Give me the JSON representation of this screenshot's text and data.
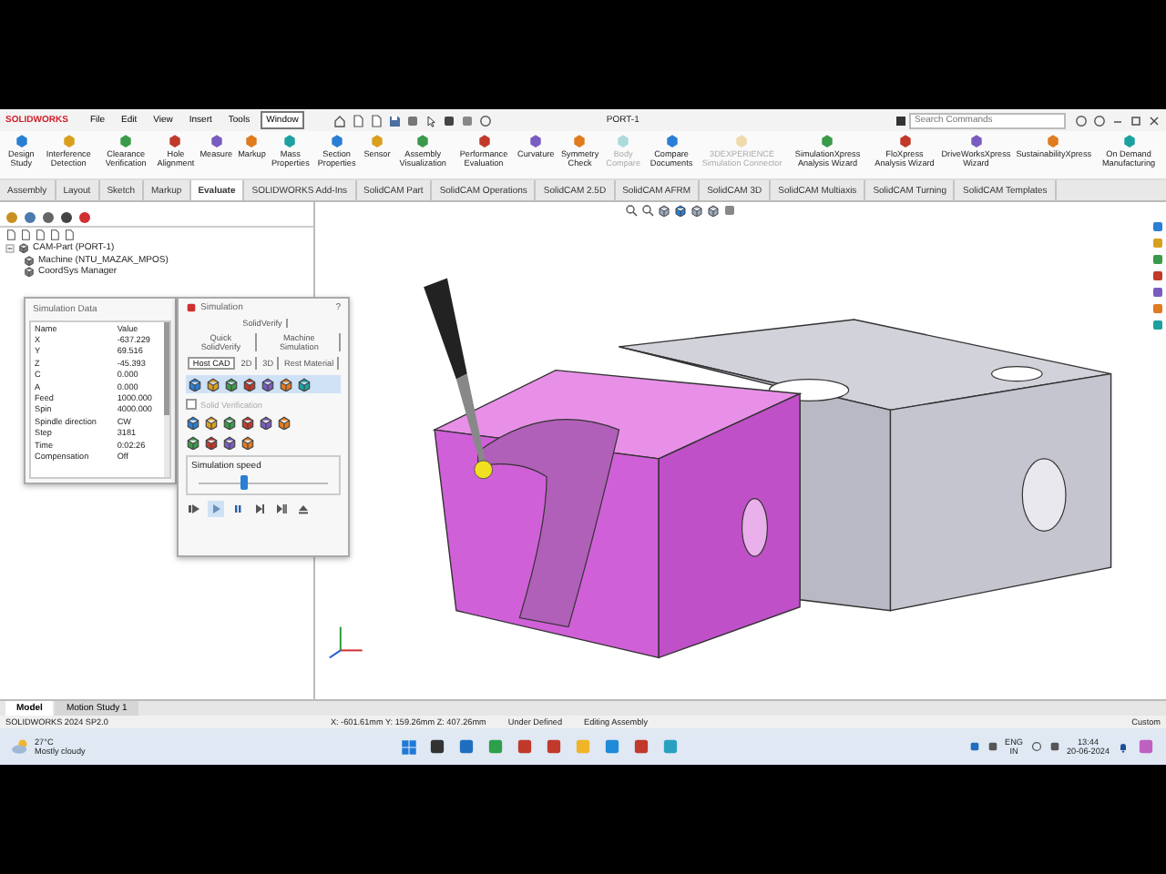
{
  "title_bar": {
    "logo": "SOLIDWORKS",
    "menus": [
      {
        "label": "File",
        "selected": false
      },
      {
        "label": "Edit",
        "selected": false
      },
      {
        "label": "View",
        "selected": false
      },
      {
        "label": "Insert",
        "selected": false
      },
      {
        "label": "Tools",
        "selected": false
      },
      {
        "label": "Window",
        "selected": true
      }
    ],
    "document_title": "PORT-1",
    "search": {
      "placeholder": "Search Commands"
    }
  },
  "ribbon": {
    "buttons": [
      {
        "label": "Design Study",
        "disabled": false
      },
      {
        "label": "Interference Detection",
        "disabled": false
      },
      {
        "label": "Clearance Verification",
        "disabled": false
      },
      {
        "label": "Hole Alignment",
        "disabled": false
      },
      {
        "label": "Measure",
        "disabled": false
      },
      {
        "label": "Markup",
        "disabled": false
      },
      {
        "label": "Mass Properties",
        "disabled": false
      },
      {
        "label": "Section Properties",
        "disabled": false
      },
      {
        "label": "Sensor",
        "disabled": false
      },
      {
        "label": "Assembly Visualization",
        "disabled": false
      },
      {
        "label": "Performance Evaluation",
        "disabled": false
      },
      {
        "label": "Curvature",
        "disabled": false
      },
      {
        "label": "Symmetry Check",
        "disabled": false
      },
      {
        "label": "Body Compare",
        "disabled": true
      },
      {
        "label": "Compare Documents",
        "disabled": false
      },
      {
        "label": "3DEXPERIENCE Simulation Connector",
        "disabled": true
      },
      {
        "label": "SimulationXpress Analysis Wizard",
        "disabled": false
      },
      {
        "label": "FloXpress Analysis Wizard",
        "disabled": false
      },
      {
        "label": "DriveWorksXpress Wizard",
        "disabled": false
      },
      {
        "label": "SustainabilityXpress",
        "disabled": false
      },
      {
        "label": "On Demand Manufacturing",
        "disabled": false
      }
    ]
  },
  "command_tabs": [
    {
      "label": "Assembly",
      "selected": false
    },
    {
      "label": "Layout",
      "selected": false
    },
    {
      "label": "Sketch",
      "selected": false
    },
    {
      "label": "Markup",
      "selected": false
    },
    {
      "label": "Evaluate",
      "selected": true
    },
    {
      "label": "SOLIDWORKS Add-Ins",
      "selected": false
    },
    {
      "label": "SolidCAM Part",
      "selected": false
    },
    {
      "label": "SolidCAM Operations",
      "selected": false
    },
    {
      "label": "SolidCAM 2.5D",
      "selected": false
    },
    {
      "label": "SolidCAM AFRM",
      "selected": false
    },
    {
      "label": "SolidCAM 3D",
      "selected": false
    },
    {
      "label": "SolidCAM Multiaxis",
      "selected": false
    },
    {
      "label": "SolidCAM Turning",
      "selected": false
    },
    {
      "label": "SolidCAM Templates",
      "selected": false
    }
  ],
  "feature_tree": {
    "items": [
      {
        "label": "CAM-Part (PORT-1)",
        "expanded": true,
        "children": [
          {
            "label": "Machine (NTU_MAZAK_MPOS)"
          },
          {
            "label": "CoordSys Manager"
          }
        ]
      }
    ]
  },
  "simulation_data": {
    "title": "Simulation Data",
    "columns": [
      "Name",
      "Value"
    ],
    "rows": [
      [
        "X",
        "-637.229"
      ],
      [
        "Y",
        "69.516"
      ],
      [
        "Z",
        "-45.393"
      ],
      [
        "C",
        "0.000"
      ],
      [
        "A",
        "0.000"
      ],
      [
        "Feed",
        "1000.000"
      ],
      [
        "Spin",
        "4000.000"
      ],
      [
        "Spindle direction",
        "CW"
      ],
      [
        "Step",
        "3181"
      ],
      [
        "Time",
        "0:02:26"
      ],
      [
        "Compensation",
        "Off"
      ]
    ]
  },
  "simulation": {
    "title": "Simulation",
    "help": "?",
    "tab_rows": [
      [
        {
          "label": "SolidVerify",
          "selected": false
        }
      ],
      [
        {
          "label": "Quick SolidVerify",
          "selected": false
        },
        {
          "label": "Machine Simulation",
          "selected": false
        }
      ],
      [
        {
          "label": "Host CAD",
          "selected": true
        },
        {
          "label": "2D",
          "selected": false
        },
        {
          "label": "3D",
          "selected": false
        },
        {
          "label": "Rest Material",
          "selected": false
        }
      ]
    ],
    "solid_verification": {
      "label": "Solid Verification",
      "checked": false,
      "disabled": true
    },
    "speed": {
      "label": "Simulation speed",
      "level": 0.35
    },
    "playback": [
      {
        "kind": "run",
        "selected": false
      },
      {
        "kind": "play",
        "selected": true
      },
      {
        "kind": "pause",
        "selected": false
      },
      {
        "kind": "step",
        "selected": false
      },
      {
        "kind": "skip",
        "selected": false
      },
      {
        "kind": "eject",
        "selected": false
      }
    ]
  },
  "model_tabs": [
    {
      "label": "Model",
      "selected": true
    },
    {
      "label": "Motion Study 1",
      "selected": false
    }
  ],
  "status_bar": {
    "version": "SOLIDWORKS 2024 SP2.0",
    "coordinates": "X: -601.61mm Y: 159.26mm Z: 407.26mm",
    "state": "Under Defined",
    "mode": "Editing Assembly",
    "units": "Custom"
  },
  "taskbar": {
    "weather": {
      "temperature": "27°C",
      "condition": "Mostly cloudy"
    },
    "language": [
      "ENG",
      "IN"
    ],
    "time": "13:44",
    "date": "20-06-2024"
  }
}
